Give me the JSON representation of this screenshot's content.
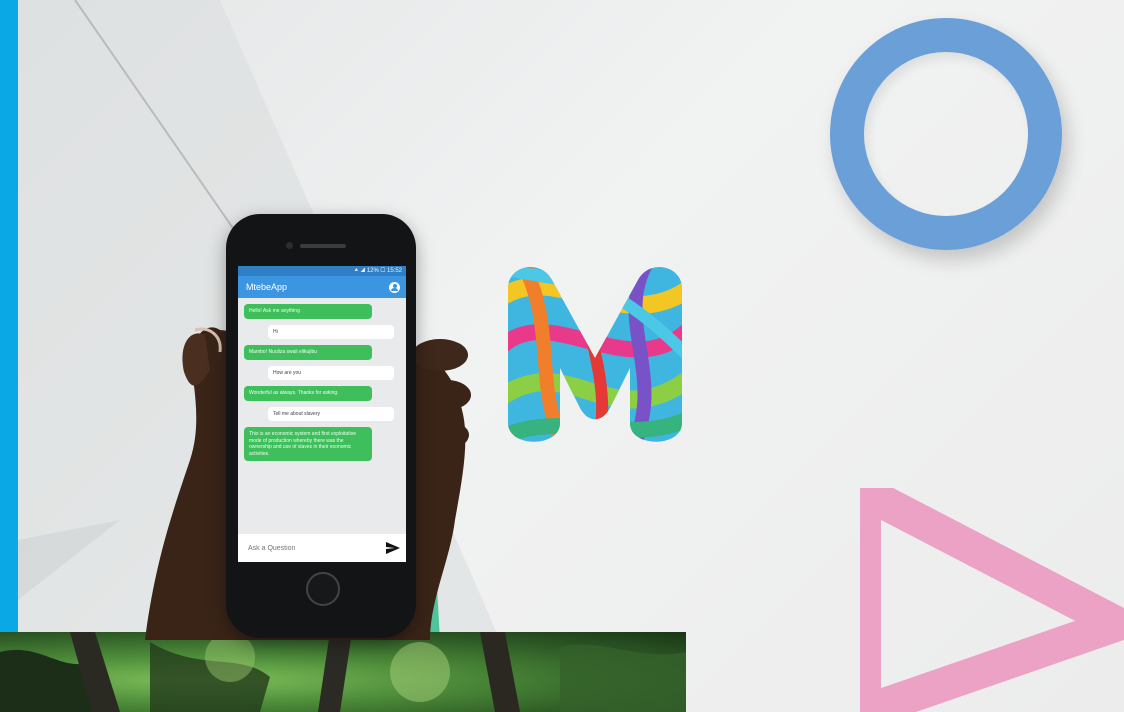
{
  "app": {
    "title": "MtebeApp",
    "status_bar": "⯅ ◢ 12% ▢ 15:52"
  },
  "chat": {
    "messages": [
      {
        "from": "bot",
        "text": "Hello! Ask me anything"
      },
      {
        "from": "user",
        "text": "Hi"
      },
      {
        "from": "bot",
        "text": "Mambo! Nuuliza swali elikujibu"
      },
      {
        "from": "user",
        "text": "How are you"
      },
      {
        "from": "bot",
        "text": "Wonderful as always. Thanks for asking."
      },
      {
        "from": "user",
        "text": "Tell me about slavery"
      },
      {
        "from": "bot",
        "text": "This is an economic system and first exploitative mode of production whereby there was the ownership and use of slaves in their economic activities."
      }
    ]
  },
  "input": {
    "placeholder": "Ask a Question"
  },
  "icons": {
    "account": "account-circle-icon",
    "send": "send-icon",
    "logo": "m-logo"
  },
  "colors": {
    "left_bar": "#0aa8e4",
    "ring": "#6b9fd8",
    "triangle": "#eba2c4",
    "appbar": "#3b95e0",
    "bot_bubble": "#3ebf5b"
  }
}
